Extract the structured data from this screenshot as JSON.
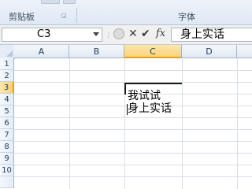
{
  "ribbon": {
    "groups": [
      {
        "label": "剪贴板"
      },
      {
        "label": "字体"
      }
    ],
    "launcher_icon": "dialog-launcher-icon"
  },
  "formula_bar": {
    "name_box": "C3",
    "cancel_symbol": "✕",
    "enter_symbol": "✔",
    "fx_symbol": "fx",
    "content": "身上实话"
  },
  "sheet": {
    "columns": [
      "A",
      "B",
      "C",
      "D"
    ],
    "selected_column": "C",
    "rows": [
      "1",
      "2",
      "3",
      "4",
      "5",
      "6",
      "7",
      "8",
      "9",
      "10"
    ],
    "selected_row": "3",
    "cells": {
      "C3_line1": "我试试",
      "C3_line2": "身上实话"
    }
  },
  "colors": {
    "selection_header": "#f9d37b",
    "header_blue": "#e4ecf7",
    "grid_line": "#d8dfe8"
  }
}
